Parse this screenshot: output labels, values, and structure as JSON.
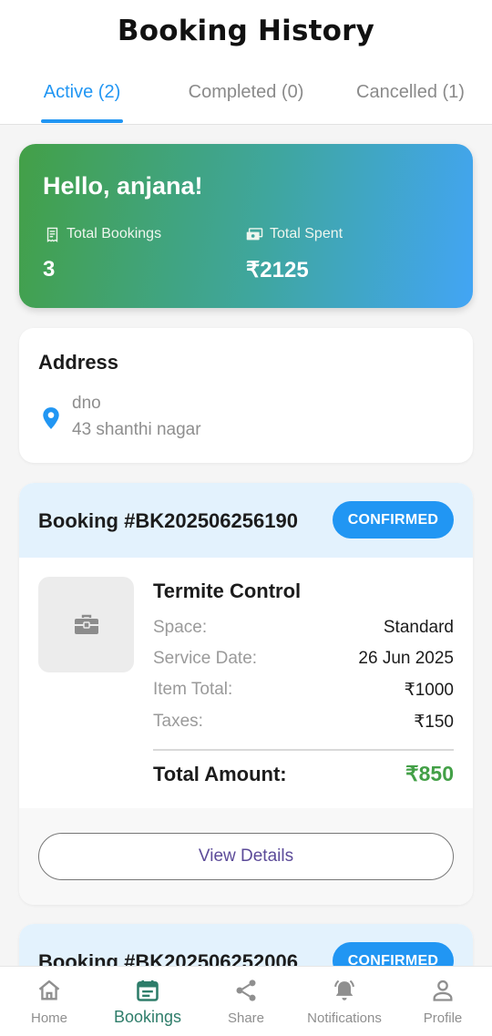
{
  "header": {
    "title": "Booking History"
  },
  "tabs": [
    {
      "label": "Active (2)",
      "active": true
    },
    {
      "label": "Completed (0)",
      "active": false
    },
    {
      "label": "Cancelled (1)",
      "active": false
    }
  ],
  "greeting": {
    "title": "Hello, anjana!",
    "total_bookings_label": "Total Bookings",
    "total_bookings_value": "3",
    "total_spent_label": "Total Spent",
    "total_spent_value": "₹2125",
    "gradient_colors": [
      "#43a047",
      "#42a5f5"
    ]
  },
  "address": {
    "title": "Address",
    "line1": "dno",
    "line2": "43 shanthi nagar",
    "icon": "location-pin-icon"
  },
  "bookings": [
    {
      "id": "Booking #BK202506256190",
      "status": "CONFIRMED",
      "service": "Termite Control",
      "rows": [
        {
          "label": "Space:",
          "value": "Standard"
        },
        {
          "label": "Service Date:",
          "value": "26 Jun 2025"
        },
        {
          "label": "Item Total:",
          "value": "₹1000"
        },
        {
          "label": "Taxes:",
          "value": "₹150"
        }
      ],
      "total_label": "Total Amount:",
      "total_value": "₹850",
      "view_label": "View Details"
    },
    {
      "id": "Booking #BK202506252006",
      "status": "CONFIRMED"
    }
  ],
  "nav": [
    {
      "label": "Home",
      "icon": "home-icon",
      "active": false
    },
    {
      "label": "Bookings",
      "icon": "calendar-icon",
      "active": true
    },
    {
      "label": "Share",
      "icon": "share-icon",
      "active": false
    },
    {
      "label": "Notifications",
      "icon": "bell-icon",
      "active": false
    },
    {
      "label": "Profile",
      "icon": "person-icon",
      "active": false
    }
  ],
  "colors": {
    "accent": "#2196f3",
    "total_green": "#43a047",
    "nav_active": "#2e7d6a",
    "button_text": "#5c4b99"
  }
}
